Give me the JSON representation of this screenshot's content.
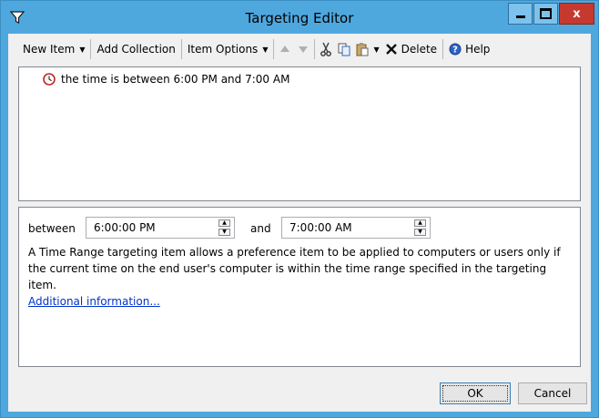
{
  "window": {
    "title": "Targeting Editor",
    "title_icon": "filter-funnel-icon",
    "controls": {
      "minimize": "minimize-icon",
      "maximize": "maximize-icon",
      "close_label": "x"
    }
  },
  "toolbar": {
    "new_item": "New Item",
    "add_collection": "Add Collection",
    "item_options": "Item Options",
    "delete": "Delete",
    "help": "Help"
  },
  "tree": {
    "items": [
      {
        "label": "the time is between 6:00 PM and 7:00 AM",
        "icon": "clock-icon"
      }
    ]
  },
  "properties": {
    "between_label": "between",
    "start_time": "6:00:00 PM",
    "and_label": "and",
    "end_time": "7:00:00 AM",
    "description": "A Time Range targeting item allows a preference item to be applied to computers or users only if the current time on the end user's computer is within the time range specified in the targeting item.",
    "more_link": "Additional information..."
  },
  "buttons": {
    "ok": "OK",
    "cancel": "Cancel"
  },
  "colors": {
    "titlebar": "#4ea8de",
    "close_button": "#c7392e",
    "link": "#0033cc",
    "clock": "#c0261e"
  }
}
